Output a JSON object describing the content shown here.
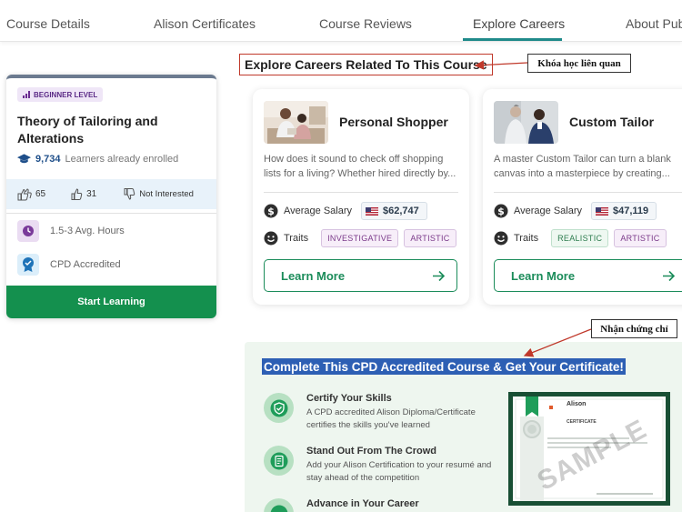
{
  "tabs": [
    {
      "label": "Course Details"
    },
    {
      "label": "Alison Certificates"
    },
    {
      "label": "Course Reviews"
    },
    {
      "label": "Explore Careers"
    },
    {
      "label": "About Publ"
    }
  ],
  "sidebar": {
    "level_badge": "BEGINNER LEVEL",
    "course_title": "Theory of Tailoring and Alterations",
    "enrolled_count": "9,734",
    "enrolled_text": "Learners already enrolled",
    "likes": "65",
    "thumbs_up": "31",
    "not_interested": "Not Interested",
    "hours": "1.5-3 Avg. Hours",
    "accreditation": "CPD Accredited",
    "start_button": "Start Learning"
  },
  "annotations": {
    "careers_note": "Khóa học liên quan",
    "certificate_note": "Nhận chứng chỉ"
  },
  "careers_section": {
    "heading": "Explore Careers Related To This Course",
    "salary_label": "Average Salary",
    "traits_label": "Traits",
    "learn_more": "Learn More",
    "cards": [
      {
        "title": "Personal Shopper",
        "description": "How does it sound to check off shopping lists for a living? Whether hired directly by...",
        "salary": "$62,747",
        "traits": [
          "INVESTIGATIVE",
          "ARTISTIC"
        ]
      },
      {
        "title": "Custom Tailor",
        "description": "A master Custom Tailor can turn a blank canvas into a masterpiece by creating...",
        "salary": "$47,119",
        "traits": [
          "REALISTIC",
          "ARTISTIC"
        ]
      }
    ]
  },
  "certificate_section": {
    "heading": "Complete This CPD Accredited Course & Get Your Certificate!",
    "benefits": [
      {
        "title": "Certify Your Skills",
        "text": "A CPD accredited Alison Diploma/Certificate certifies the skills you've learned"
      },
      {
        "title": "Stand Out From The Crowd",
        "text": "Add your Alison Certification to your resumé and stay ahead of the competition"
      },
      {
        "title": "Advance in Your Career",
        "text": ""
      }
    ],
    "sample": {
      "brand": "Alison",
      "doc_title": "CERTIFICATE",
      "watermark": "SAMPLE"
    }
  },
  "colors": {
    "accent_green": "#14904e",
    "tab_underline": "#1f8a8a",
    "heading_highlight": "#2d5fb4",
    "annotation_red": "#c0392b"
  }
}
